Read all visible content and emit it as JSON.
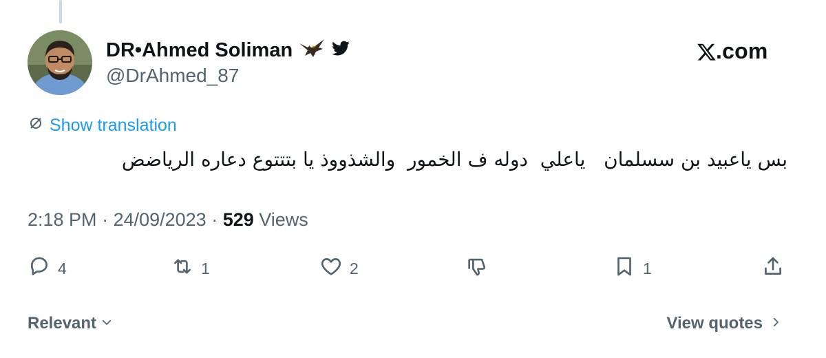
{
  "author": {
    "display_name": "DR•Ahmed Soliman",
    "handle": "@DrAhmed_87",
    "avatar_icon": "profile-photo",
    "badge_icons": [
      "eagle-icon",
      "bird-icon"
    ]
  },
  "brand": {
    "label": ".com",
    "icon": "x-logo-icon"
  },
  "translation": {
    "label": "Show translation",
    "icon": "translate-icon"
  },
  "tweet": {
    "text": "بس ياعبيد بن سسلمان   ياعلي  دوله ف الخمور  والشذووذ يا بتتتوع دعاره الرياضض"
  },
  "meta": {
    "time": "2:18 PM",
    "separator": " · ",
    "date": "24/09/2023",
    "views_count": "529",
    "views_label": " Views"
  },
  "actions": {
    "reply": {
      "count": "4",
      "icon": "reply-icon"
    },
    "repost": {
      "count": "1",
      "icon": "repost-icon"
    },
    "like": {
      "count": "2",
      "icon": "heart-icon"
    },
    "dislike": {
      "icon": "thumbs-down-icon"
    },
    "bookmark": {
      "count": "1",
      "icon": "bookmark-icon"
    },
    "share": {
      "icon": "share-icon"
    }
  },
  "footer": {
    "sort_label": "Relevant",
    "quotes_label": "View quotes"
  },
  "colors": {
    "text_primary": "#0f1419",
    "text_secondary": "#536471",
    "accent": "#1d9bf0",
    "thread_line": "#cfd9de"
  }
}
